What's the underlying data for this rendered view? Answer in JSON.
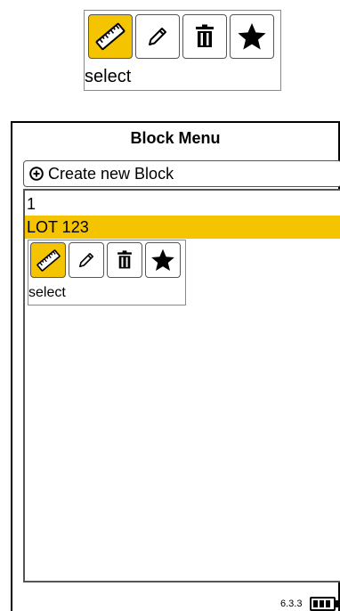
{
  "top_palette": {
    "tools": [
      {
        "icon": "ruler-icon",
        "active": true
      },
      {
        "icon": "pencil-icon",
        "active": false
      },
      {
        "icon": "trash-icon",
        "active": false
      },
      {
        "icon": "star-icon",
        "active": false
      }
    ],
    "caption": "select"
  },
  "window": {
    "title": "Block Menu",
    "create_button_label": "Create new Block",
    "items": [
      {
        "label": "1",
        "selected": false
      },
      {
        "label": "LOT 123",
        "selected": true
      }
    ]
  },
  "item_palette": {
    "tools": [
      {
        "icon": "ruler-icon",
        "active": true
      },
      {
        "icon": "pencil-icon",
        "active": false
      },
      {
        "icon": "trash-icon",
        "active": false
      },
      {
        "icon": "star-icon",
        "active": false
      }
    ],
    "caption": "select"
  },
  "footer": {
    "version": "6.3.3",
    "battery_level": 1.0
  },
  "colors": {
    "accent": "#f5c400",
    "border": "#555555"
  }
}
